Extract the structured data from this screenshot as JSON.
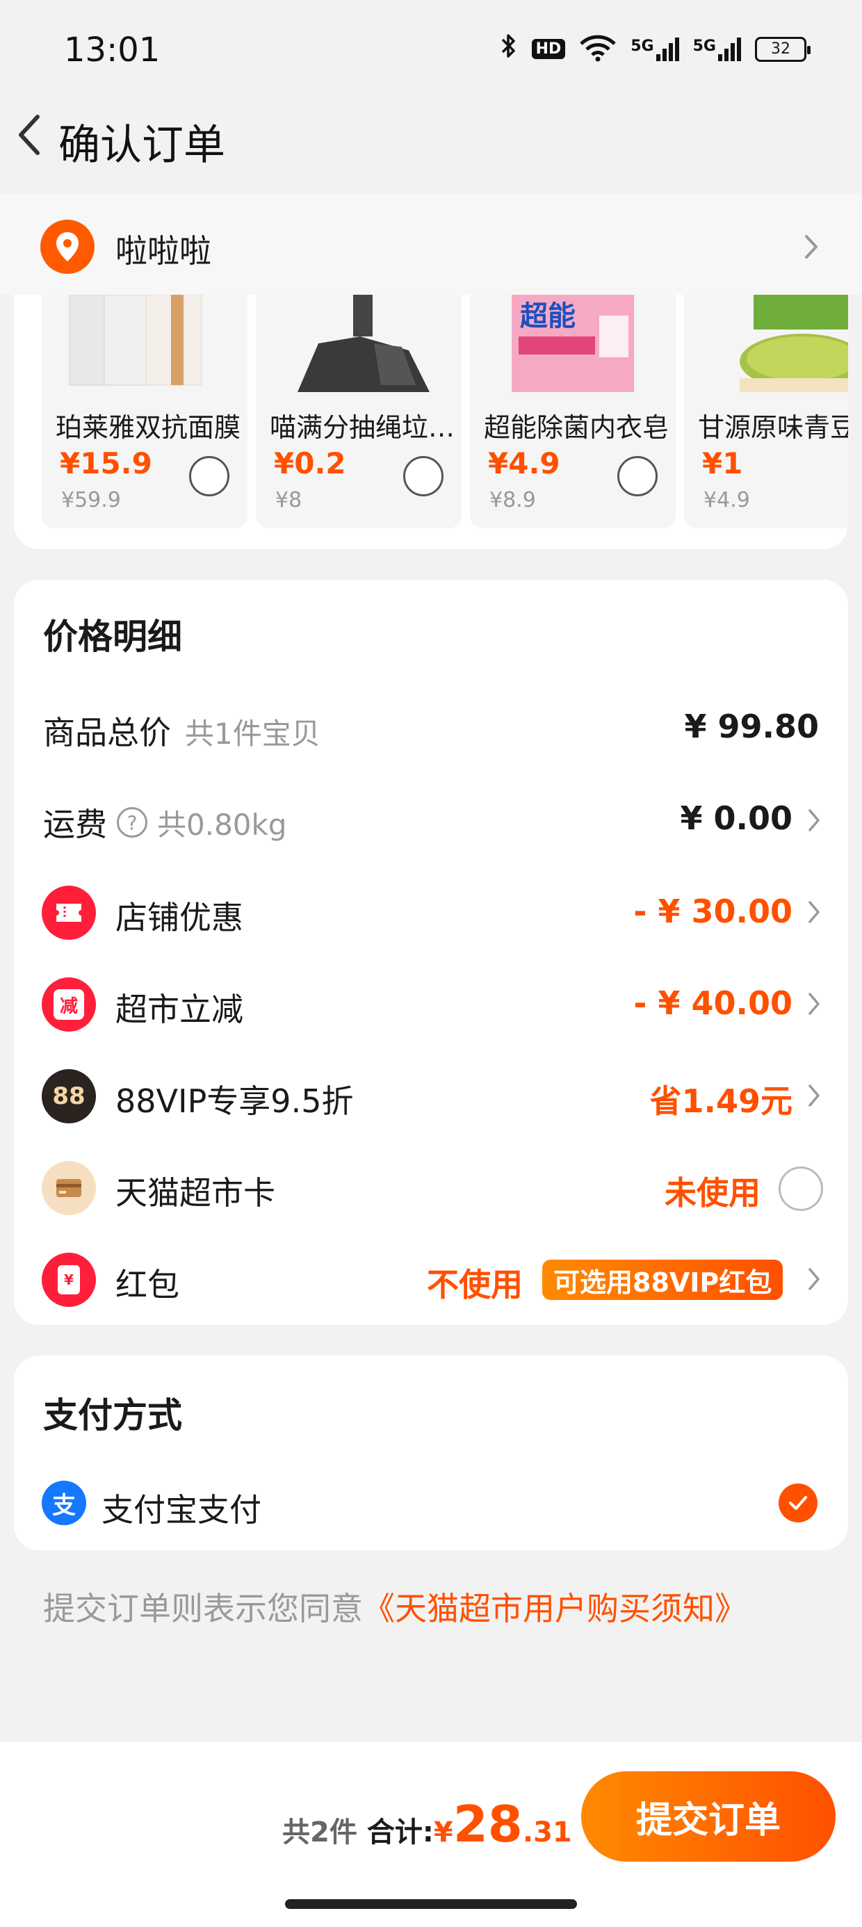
{
  "status_bar": {
    "time": "13:01",
    "hd_label": "HD",
    "sig1_label": "5G",
    "sig2_label": "5G",
    "battery": "32"
  },
  "header": {
    "title": "确认订单"
  },
  "address": {
    "text": "啦啦啦"
  },
  "products": [
    {
      "name": "珀莱雅双抗面膜",
      "price": "¥15.9",
      "original": "¥59.9"
    },
    {
      "name": "喵满分抽绳垃圾袋",
      "price": "¥0.2",
      "original": "¥8"
    },
    {
      "name": "超能除菌内衣皂",
      "price": "¥4.9",
      "original": "¥8.9"
    },
    {
      "name": "甘源原味青豆",
      "price": "¥1",
      "original": "¥4.9"
    }
  ],
  "price_detail": {
    "title": "价格明细",
    "subtotal": {
      "label": "商品总价",
      "sub": "共1件宝贝",
      "value": "¥ 99.80"
    },
    "shipping": {
      "label": "运费",
      "sub": "共0.80kg",
      "value": "¥ 0.00"
    },
    "shop_discount": {
      "label": "店铺优惠",
      "value": "- ¥ 30.00"
    },
    "market_discount": {
      "label": "超市立减",
      "value": "- ¥ 40.00",
      "icon_text": "减"
    },
    "vip": {
      "label": "88VIP专享9.5折",
      "value": "省1.49元",
      "icon_text": "88"
    },
    "card": {
      "label": "天猫超市卡",
      "value": "未使用"
    },
    "red_packet": {
      "label": "红包",
      "value": "不使用",
      "badge": "可选用88VIP红包",
      "icon_text": "¥"
    }
  },
  "payment": {
    "title": "支付方式",
    "method": "支付宝支付",
    "icon_text": "支"
  },
  "agreement": {
    "prefix": "提交订单则表示您同意",
    "link": "《天猫超市用户购买须知》"
  },
  "bottom": {
    "count": "共2件",
    "total_label": "合计:",
    "currency": "¥",
    "total_int": "28",
    "total_dec": ".31",
    "submit_label": "提交订单"
  },
  "colors": {
    "accent": "#ff5000",
    "accent_light": "#ff8a00",
    "background": "#f2f2f2"
  }
}
